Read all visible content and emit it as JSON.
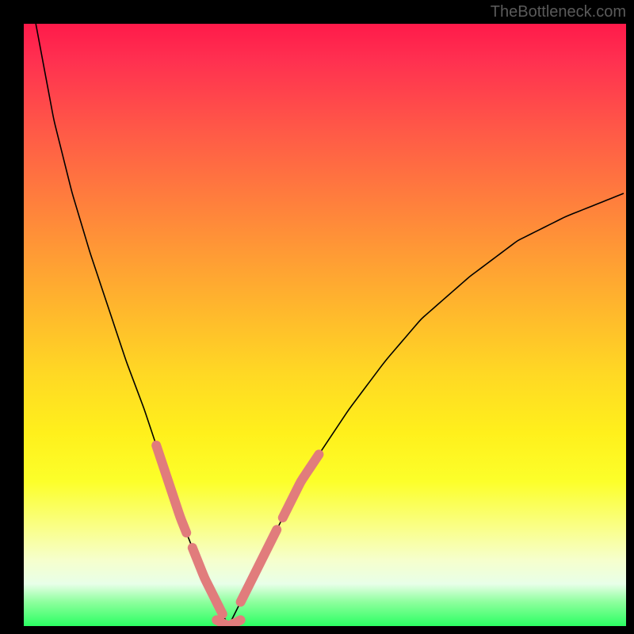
{
  "watermark": "TheBottleneck.com",
  "chart_data": {
    "type": "line",
    "title": "",
    "xlabel": "",
    "ylabel": "",
    "xlim": [
      0,
      100
    ],
    "ylim": [
      0,
      100
    ],
    "grid": false,
    "legend_position": "none",
    "series": [
      {
        "name": "left-branch",
        "x": [
          2,
          5,
          8,
          11,
          14,
          17,
          20,
          22,
          24,
          26,
          28,
          30,
          32,
          33,
          34
        ],
        "y": [
          100,
          84,
          72,
          62,
          53,
          44,
          36,
          30,
          24,
          18,
          13,
          8,
          4,
          2,
          0
        ]
      },
      {
        "name": "right-branch",
        "x": [
          34,
          35,
          36,
          38,
          40,
          43,
          46,
          50,
          54,
          60,
          66,
          74,
          82,
          90,
          100
        ],
        "y": [
          0,
          2,
          4,
          8,
          12,
          18,
          24,
          30,
          36,
          44,
          51,
          58,
          64,
          68,
          72
        ]
      }
    ],
    "highlight_segments": [
      {
        "name": "left-upper",
        "branch": "left",
        "x_start": 22,
        "x_end": 27
      },
      {
        "name": "left-lower",
        "branch": "left",
        "x_start": 28,
        "x_end": 33
      },
      {
        "name": "bottom",
        "branch": "min",
        "x_start": 32,
        "x_end": 36
      },
      {
        "name": "right-lower",
        "branch": "right",
        "x_start": 36,
        "x_end": 42
      },
      {
        "name": "right-upper",
        "branch": "right",
        "x_start": 43,
        "x_end": 49
      }
    ],
    "colors": {
      "curve": "#000000",
      "highlight": "#e17c7c"
    }
  }
}
